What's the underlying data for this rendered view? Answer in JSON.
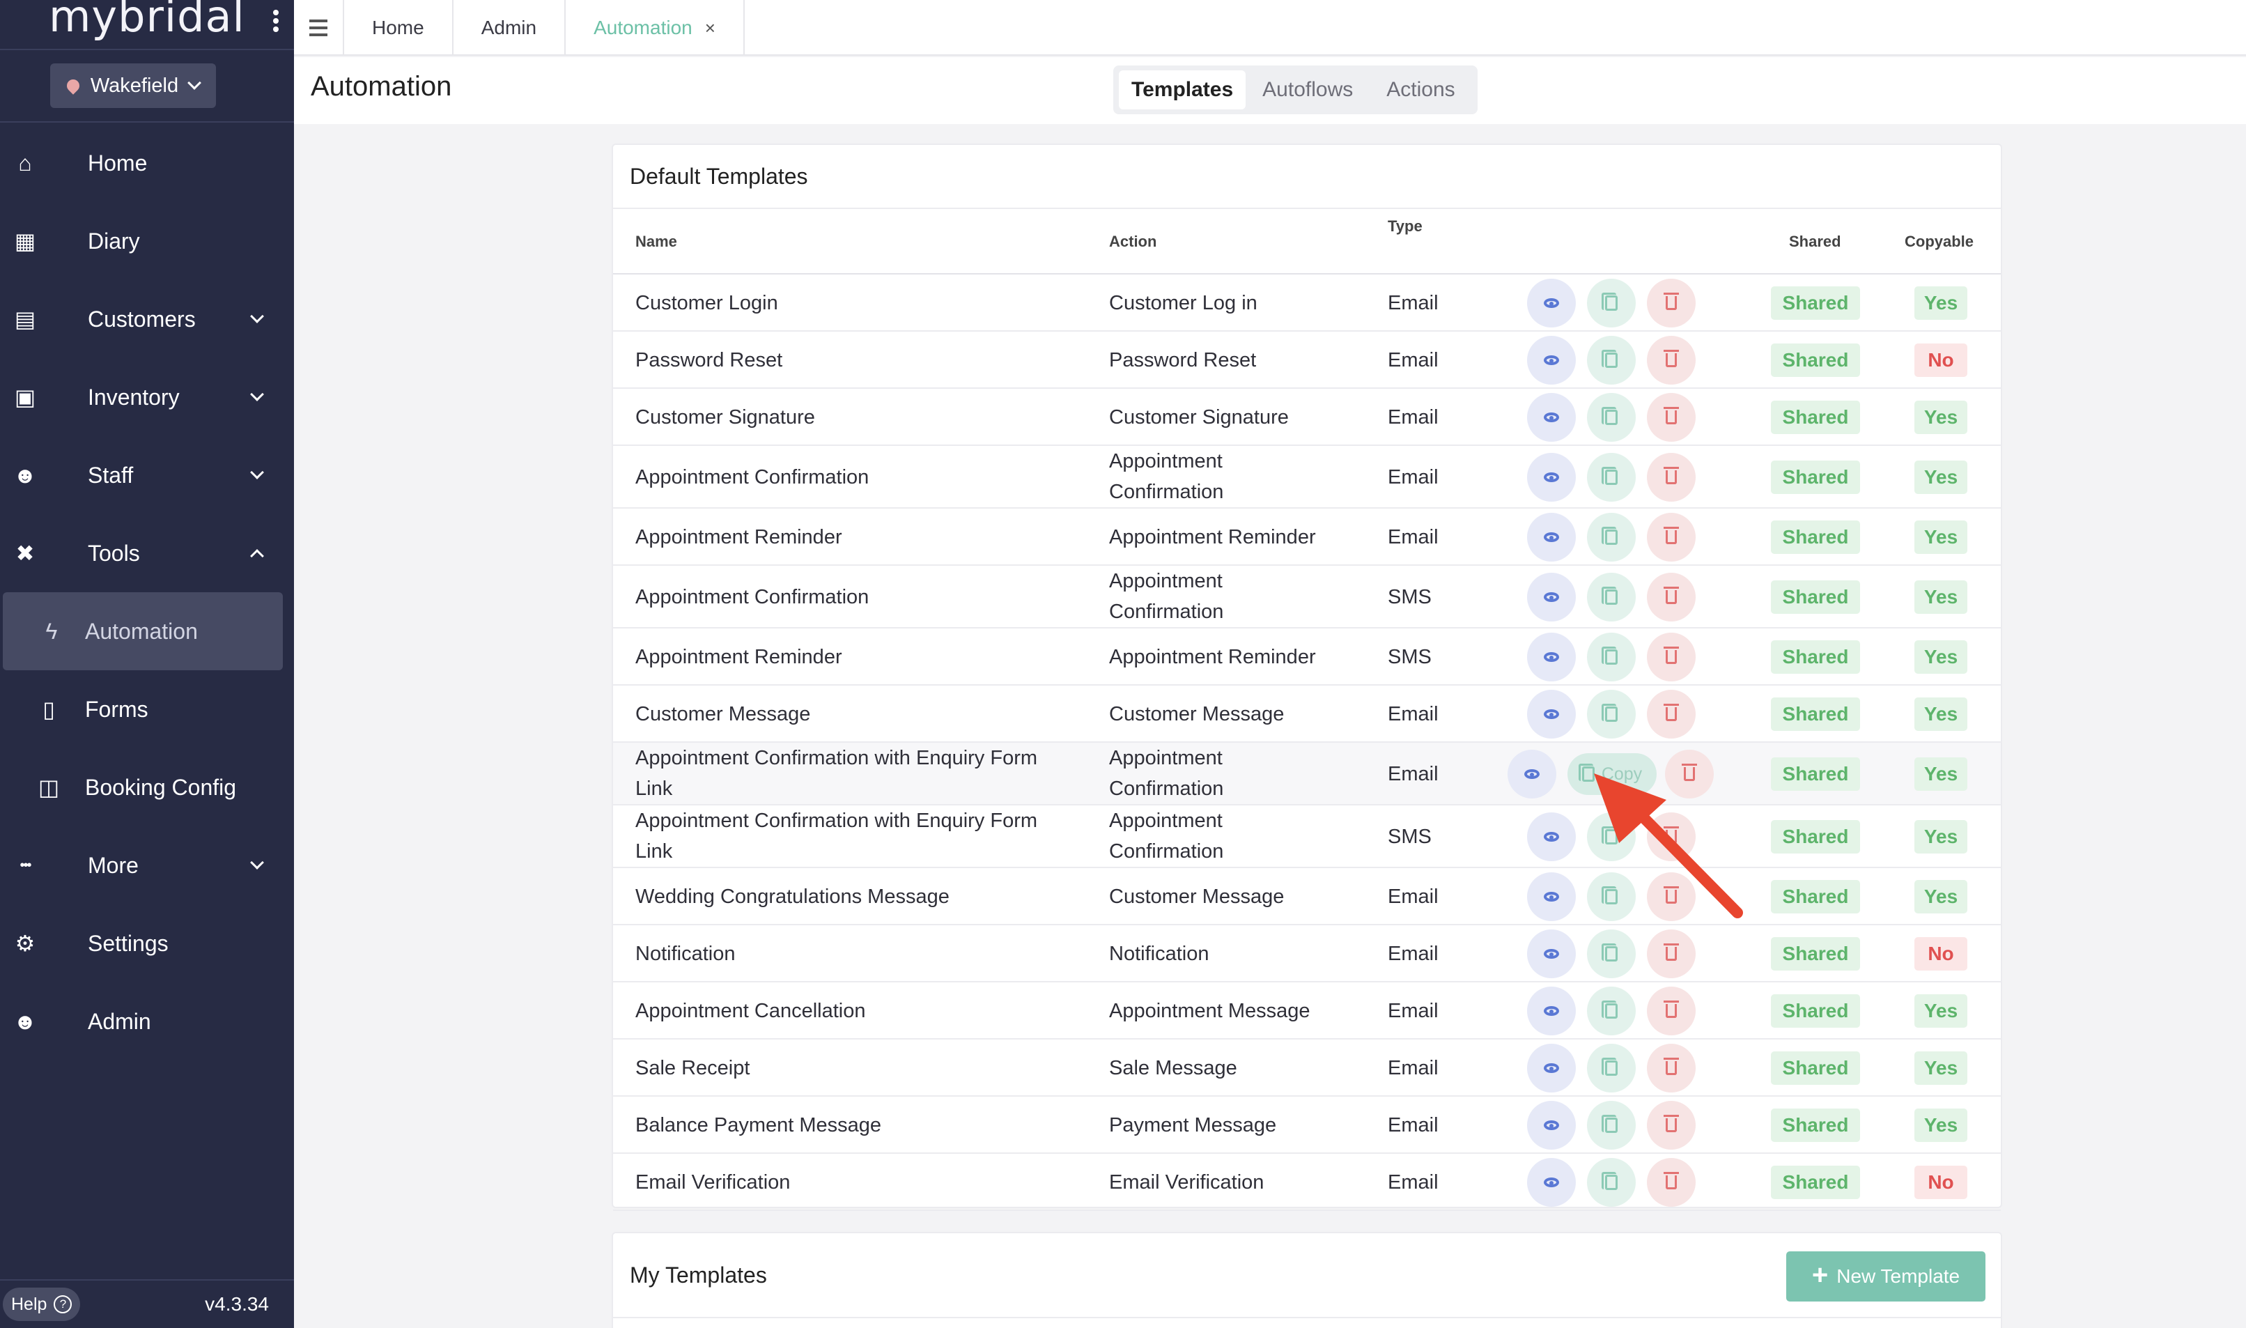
{
  "app": {
    "logo": "mybridal",
    "branch": "Wakefield",
    "version": "v4.3.34",
    "help_label": "Help"
  },
  "sidebar": {
    "items": [
      {
        "label": "Home",
        "icon": "home-icon",
        "glyph": "⌂"
      },
      {
        "label": "Diary",
        "icon": "calendar-icon",
        "glyph": "▦"
      },
      {
        "label": "Customers",
        "icon": "contact-card-icon",
        "glyph": "▤"
      },
      {
        "label": "Inventory",
        "icon": "boxes-icon",
        "glyph": "▣"
      },
      {
        "label": "Staff",
        "icon": "users-icon",
        "glyph": "☻"
      },
      {
        "label": "Tools",
        "icon": "tools-icon",
        "glyph": "✖"
      }
    ],
    "tools_sub": [
      {
        "label": "Automation",
        "icon": "automation-icon",
        "glyph": "ϟ"
      },
      {
        "label": "Forms",
        "icon": "document-icon",
        "glyph": "▯"
      },
      {
        "label": "Booking Config",
        "icon": "columns-icon",
        "glyph": "◫"
      }
    ],
    "bottom": [
      {
        "label": "More",
        "icon": "ellipsis-icon",
        "glyph": "•••"
      },
      {
        "label": "Settings",
        "icon": "gear-icon",
        "glyph": "⚙"
      },
      {
        "label": "Admin",
        "icon": "user-shield-icon",
        "glyph": "☻"
      }
    ]
  },
  "topbar": {
    "tabs": [
      "Home",
      "Admin",
      "Automation"
    ],
    "close_glyph": "×"
  },
  "header": {
    "title": "Automation",
    "segments": [
      "Templates",
      "Autoflows",
      "Actions"
    ]
  },
  "default_templates": {
    "title": "Default Templates",
    "columns": {
      "name": "Name",
      "action": "Action",
      "type": "Type",
      "shared": "Shared",
      "copyable": "Copyable"
    },
    "copy_label": "Copy",
    "rows": [
      {
        "name": "Customer Login",
        "action": "Customer Log in",
        "type": "Email",
        "shared": "Shared",
        "copyable": "Yes"
      },
      {
        "name": "Password Reset",
        "action": "Password Reset",
        "type": "Email",
        "shared": "Shared",
        "copyable": "No"
      },
      {
        "name": "Customer Signature",
        "action": "Customer Signature",
        "type": "Email",
        "shared": "Shared",
        "copyable": "Yes"
      },
      {
        "name": "Appointment Confirmation",
        "action": "Appointment Confirmation",
        "type": "Email",
        "shared": "Shared",
        "copyable": "Yes"
      },
      {
        "name": "Appointment Reminder",
        "action": "Appointment Reminder",
        "type": "Email",
        "shared": "Shared",
        "copyable": "Yes"
      },
      {
        "name": "Appointment Confirmation",
        "action": "Appointment Confirmation",
        "type": "SMS",
        "shared": "Shared",
        "copyable": "Yes"
      },
      {
        "name": "Appointment Reminder",
        "action": "Appointment Reminder",
        "type": "SMS",
        "shared": "Shared",
        "copyable": "Yes"
      },
      {
        "name": "Customer Message",
        "action": "Customer Message",
        "type": "Email",
        "shared": "Shared",
        "copyable": "Yes"
      },
      {
        "name": "Appointment Confirmation with Enquiry Form Link",
        "action": "Appointment Confirmation",
        "type": "Email",
        "shared": "Shared",
        "copyable": "Yes"
      },
      {
        "name": "Appointment Confirmation with Enquiry Form Link",
        "action": "Appointment Confirmation",
        "type": "SMS",
        "shared": "Shared",
        "copyable": "Yes"
      },
      {
        "name": "Wedding Congratulations Message",
        "action": "Customer Message",
        "type": "Email",
        "shared": "Shared",
        "copyable": "Yes"
      },
      {
        "name": "Notification",
        "action": "Notification",
        "type": "Email",
        "shared": "Shared",
        "copyable": "No"
      },
      {
        "name": "Appointment Cancellation",
        "action": "Appointment Message",
        "type": "Email",
        "shared": "Shared",
        "copyable": "Yes"
      },
      {
        "name": "Sale Receipt",
        "action": "Sale Message",
        "type": "Email",
        "shared": "Shared",
        "copyable": "Yes"
      },
      {
        "name": "Balance Payment Message",
        "action": "Payment Message",
        "type": "Email",
        "shared": "Shared",
        "copyable": "Yes"
      },
      {
        "name": "Email Verification",
        "action": "Email Verification",
        "type": "Email",
        "shared": "Shared",
        "copyable": "No"
      }
    ]
  },
  "my_templates": {
    "title": "My Templates",
    "new_button": "New Template"
  },
  "colors": {
    "sidebar_bg": "#272b44",
    "accent": "#6cc0a6",
    "annotation_arrow": "#e8452e"
  }
}
